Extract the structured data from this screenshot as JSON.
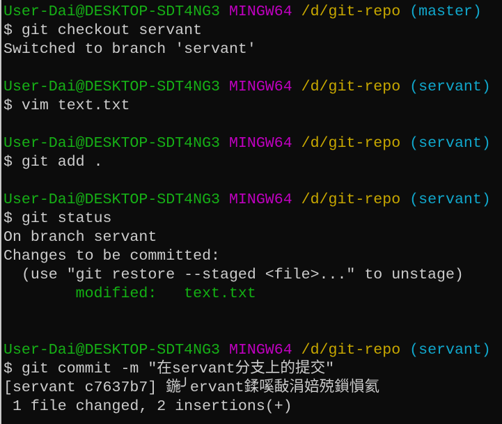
{
  "colors": {
    "text": "#cccccc",
    "user_host": "#16b016",
    "mingw": "#c000c0",
    "path": "#c8a800",
    "branch": "#11a8cd",
    "modified": "#13b013",
    "background": "#0c0c0c"
  },
  "lines": [
    [
      {
        "t": "User-Dai@DESKTOP-SDT4NG3 ",
        "c": "user_host"
      },
      {
        "t": "MINGW64 ",
        "c": "mingw"
      },
      {
        "t": "/d/git-repo ",
        "c": "path"
      },
      {
        "t": "(master)",
        "c": "branch"
      }
    ],
    [
      {
        "t": "$ git checkout servant",
        "c": "text"
      }
    ],
    [
      {
        "t": "Switched to branch 'servant'",
        "c": "text"
      }
    ],
    [],
    [
      {
        "t": "User-Dai@DESKTOP-SDT4NG3 ",
        "c": "user_host"
      },
      {
        "t": "MINGW64 ",
        "c": "mingw"
      },
      {
        "t": "/d/git-repo ",
        "c": "path"
      },
      {
        "t": "(servant)",
        "c": "branch"
      }
    ],
    [
      {
        "t": "$ vim text.txt",
        "c": "text"
      }
    ],
    [],
    [
      {
        "t": "User-Dai@DESKTOP-SDT4NG3 ",
        "c": "user_host"
      },
      {
        "t": "MINGW64 ",
        "c": "mingw"
      },
      {
        "t": "/d/git-repo ",
        "c": "path"
      },
      {
        "t": "(servant)",
        "c": "branch"
      }
    ],
    [
      {
        "t": "$ git add .",
        "c": "text"
      }
    ],
    [],
    [
      {
        "t": "User-Dai@DESKTOP-SDT4NG3 ",
        "c": "user_host"
      },
      {
        "t": "MINGW64 ",
        "c": "mingw"
      },
      {
        "t": "/d/git-repo ",
        "c": "path"
      },
      {
        "t": "(servant)",
        "c": "branch"
      }
    ],
    [
      {
        "t": "$ git status",
        "c": "text"
      }
    ],
    [
      {
        "t": "On branch servant",
        "c": "text"
      }
    ],
    [
      {
        "t": "Changes to be committed:",
        "c": "text"
      }
    ],
    [
      {
        "t": "  (use \"git restore --staged <file>...\" to unstage)",
        "c": "text"
      }
    ],
    [
      {
        "t": "        modified:   text.txt",
        "c": "modified"
      }
    ],
    [],
    [],
    [
      {
        "t": "User-Dai@DESKTOP-SDT4NG3 ",
        "c": "user_host"
      },
      {
        "t": "MINGW64 ",
        "c": "mingw"
      },
      {
        "t": "/d/git-repo ",
        "c": "path"
      },
      {
        "t": "(servant)",
        "c": "branch"
      }
    ],
    [
      {
        "t": "$ git commit -m \"在servant分支上的提交\"",
        "c": "text"
      }
    ],
    [
      {
        "t": "[servant c7637b7] 鍦╯ervant鍒嗘敮涓婄殑鎻愪氦",
        "c": "text"
      }
    ],
    [
      {
        "t": " 1 file changed, 2 insertions(+)",
        "c": "text"
      }
    ]
  ]
}
